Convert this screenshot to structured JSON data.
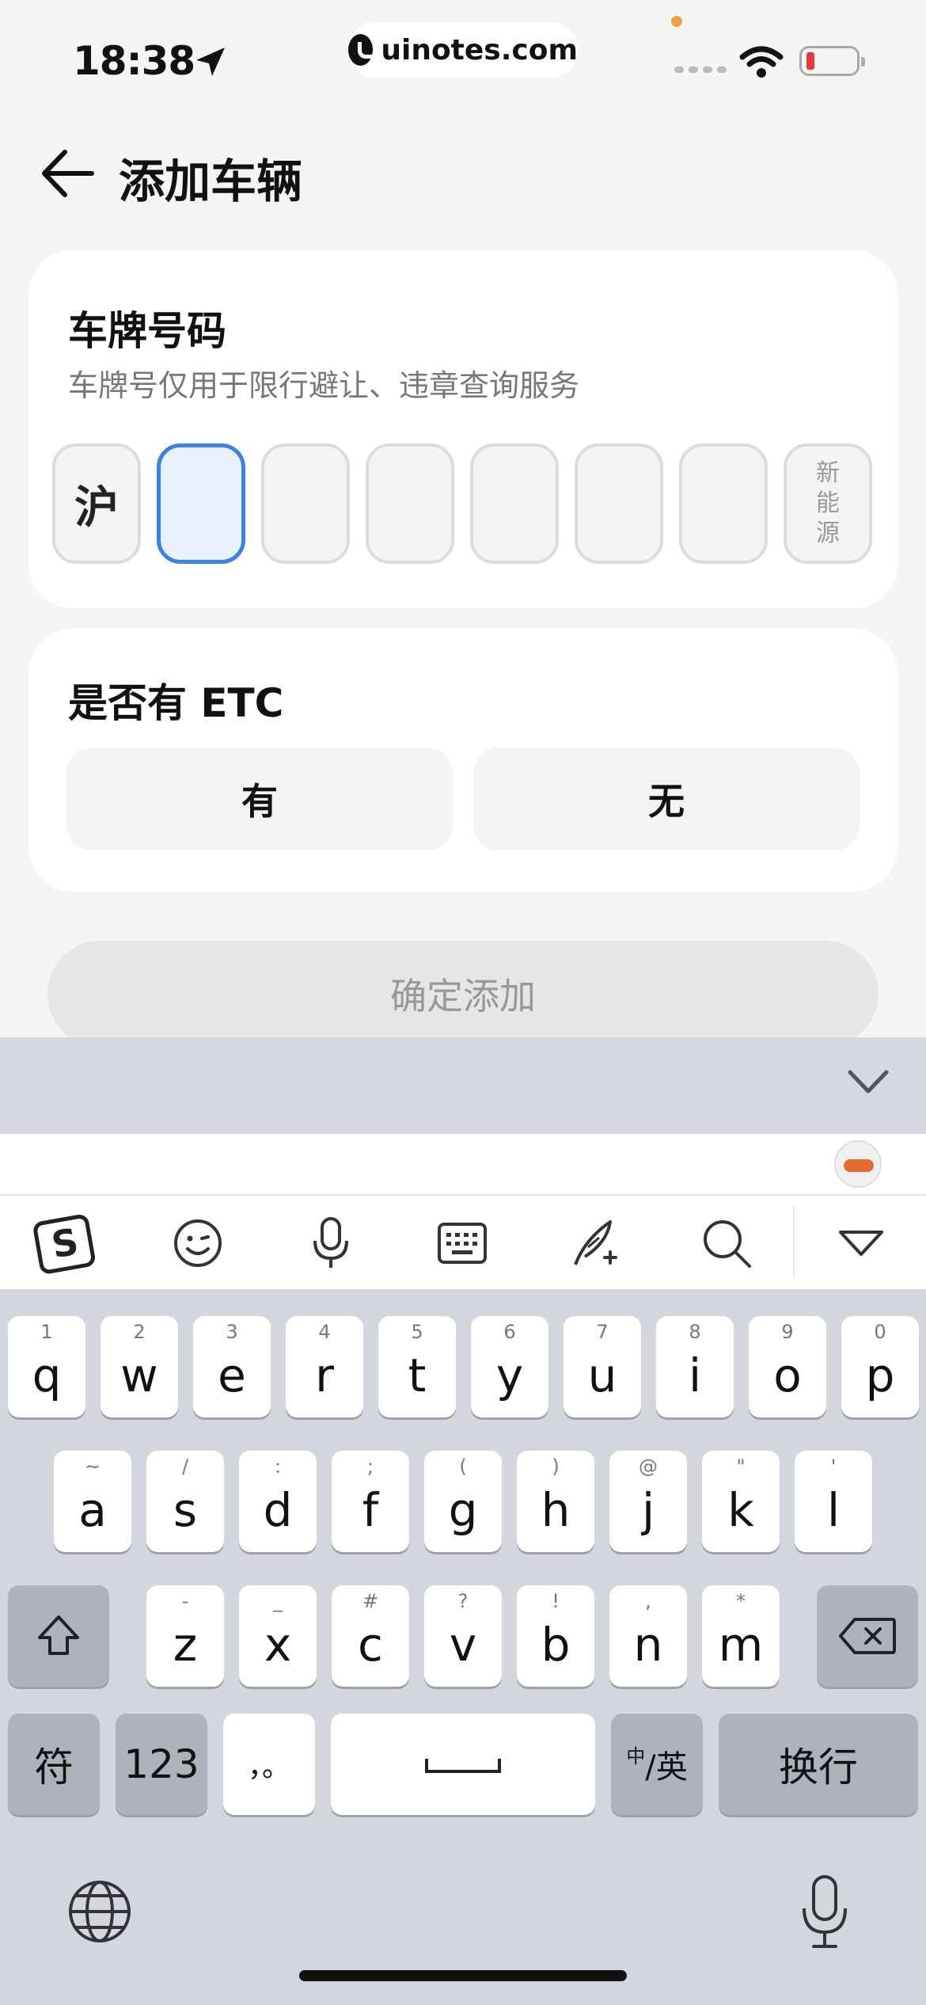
{
  "status_bar": {
    "time": "18:38",
    "url": "uinotes.com"
  },
  "header": {
    "title": "添加车辆"
  },
  "plate_card": {
    "title": "车牌号码",
    "subtitle": "车牌号仅用于限行避让、违章查询服务",
    "province": "沪",
    "slots": [
      "",
      "",
      "",
      "",
      "",
      ""
    ],
    "new_energy": [
      "新",
      "能",
      "源"
    ]
  },
  "etc_card": {
    "title": "是否有 ETC",
    "options": [
      "有",
      "无"
    ]
  },
  "confirm_button": "确定添加",
  "keyboard": {
    "row1": [
      {
        "hint": "1",
        "key": "q"
      },
      {
        "hint": "2",
        "key": "w"
      },
      {
        "hint": "3",
        "key": "e"
      },
      {
        "hint": "4",
        "key": "r"
      },
      {
        "hint": "5",
        "key": "t"
      },
      {
        "hint": "6",
        "key": "y"
      },
      {
        "hint": "7",
        "key": "u"
      },
      {
        "hint": "8",
        "key": "i"
      },
      {
        "hint": "9",
        "key": "o"
      },
      {
        "hint": "0",
        "key": "p"
      }
    ],
    "row2": [
      {
        "hint": "~",
        "key": "a"
      },
      {
        "hint": "/",
        "key": "s"
      },
      {
        "hint": ":",
        "key": "d"
      },
      {
        "hint": ";",
        "key": "f"
      },
      {
        "hint": "(",
        "key": "g"
      },
      {
        "hint": ")",
        "key": "h"
      },
      {
        "hint": "@",
        "key": "j"
      },
      {
        "hint": "\"",
        "key": "k"
      },
      {
        "hint": "'",
        "key": "l"
      }
    ],
    "row3": [
      {
        "hint": "-",
        "key": "z"
      },
      {
        "hint": "_",
        "key": "x"
      },
      {
        "hint": "#",
        "key": "c"
      },
      {
        "hint": "?",
        "key": "v"
      },
      {
        "hint": "!",
        "key": "b"
      },
      {
        "hint": ",",
        "key": "n"
      },
      {
        "hint": "*",
        "key": "m"
      }
    ],
    "symbols_key": "符",
    "numbers_key": "123",
    "punct_key": "，。",
    "lang_key_cn": "中",
    "lang_key_en": "/英",
    "return_key": "换行"
  },
  "icons": [
    "location-arrow-icon",
    "wifi-icon",
    "battery-icon",
    "back-arrow-icon",
    "chevron-down-icon",
    "sogou-logo-icon",
    "emoji-icon",
    "microphone-icon",
    "keyboard-icon",
    "handwriting-icon",
    "search-icon",
    "collapse-triangle-icon",
    "shift-icon",
    "backspace-icon",
    "globe-icon"
  ],
  "colors": {
    "accent": "#3b82e6",
    "background": "#f5f5f5",
    "keyboard": "#d3d6dc"
  }
}
